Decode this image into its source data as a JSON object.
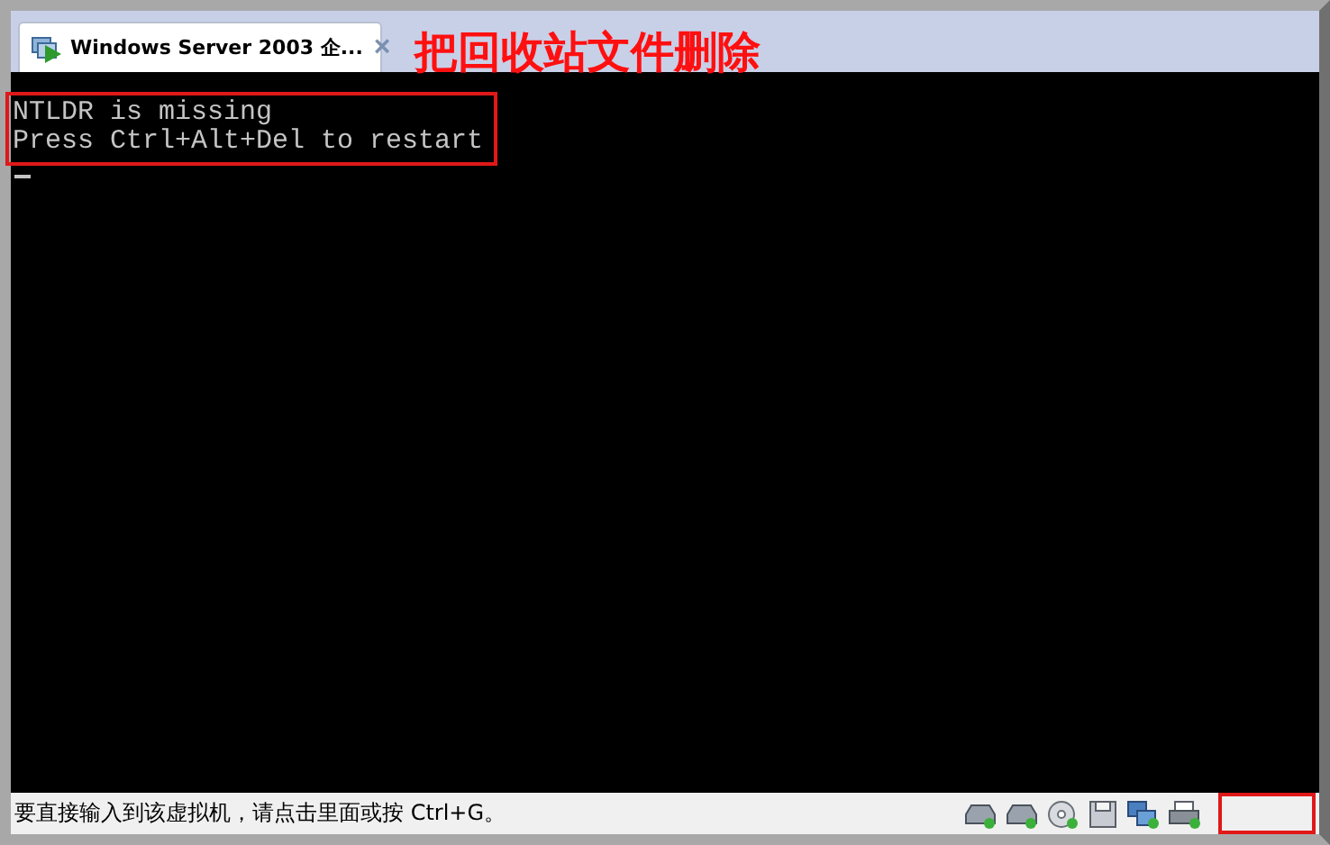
{
  "tab": {
    "title": "Windows Server 2003 企...",
    "close": "×",
    "selected": true
  },
  "annotation": {
    "text": "把回收站文件删除"
  },
  "console": {
    "lines": [
      "NTLDR is missing",
      "Press Ctrl+Alt+Del to restart"
    ]
  },
  "status_bar": {
    "message": "要直接输入到该虚拟机，请点击里面或按 Ctrl+G。",
    "devices": [
      {
        "kind": "disk"
      },
      {
        "kind": "disk"
      },
      {
        "kind": "cd"
      },
      {
        "kind": "floppy"
      },
      {
        "kind": "network"
      },
      {
        "kind": "printer"
      }
    ]
  }
}
